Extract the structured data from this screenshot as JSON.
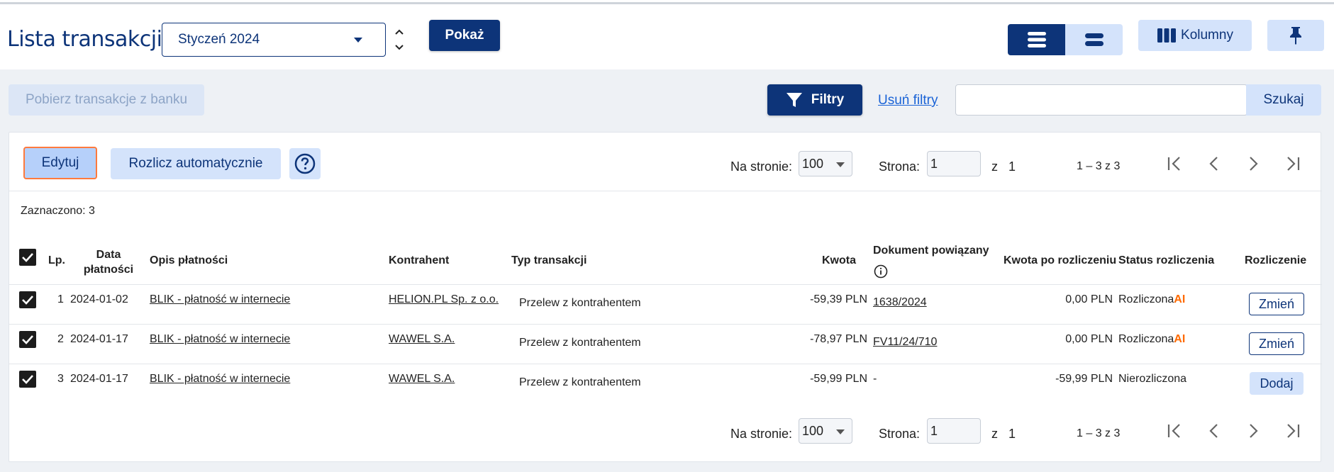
{
  "header": {
    "title": "Lista transakcji",
    "month_value": "Styczeń 2024",
    "show_label": "Pokaż",
    "columns_label": "Kolumny"
  },
  "toolbar": {
    "fetch_label": "Pobierz transakcje z banku",
    "filters_label": "Filtry",
    "clear_filters_label": "Usuń filtry",
    "search_placeholder": "",
    "search_label": "Szukaj"
  },
  "actions": {
    "edit_label": "Edytuj",
    "auto_settle_label": "Rozlicz automatycznie"
  },
  "pagination": {
    "per_page_label": "Na stronie:",
    "per_page_value": "100",
    "page_label": "Strona:",
    "page_value": "1",
    "of_label": "z",
    "total_pages": "1",
    "range_text": "1 – 3 z 3"
  },
  "selection": {
    "text": "Zaznaczono: 3"
  },
  "table": {
    "headers": {
      "lp": "Lp.",
      "date_line1": "Data",
      "date_line2": "płatności",
      "description": "Opis płatności",
      "contractor": "Kontrahent",
      "type": "Typ transakcji",
      "amount": "Kwota",
      "document": "Dokument powiązany",
      "amount_after": "Kwota po rozliczeniu",
      "status": "Status rozliczenia",
      "settlement": "Rozliczenie"
    },
    "rows": [
      {
        "lp": "1",
        "date": "2024-01-02",
        "description": "BLIK - płatność w internecie",
        "contractor": "HELION.PL Sp. z o.o.",
        "type": "Przelew z kontrahentem",
        "amount": "-59,39 PLN",
        "document": "1638/2024",
        "amount_after": "0,00 PLN",
        "status": "Rozliczona",
        "ai": "AI",
        "action": "Zmień"
      },
      {
        "lp": "2",
        "date": "2024-01-17",
        "description": "BLIK - płatność w internecie",
        "contractor": "WAWEL S.A.",
        "type": "Przelew z kontrahentem",
        "amount": "-78,97 PLN",
        "document": "FV11/24/710",
        "amount_after": "0,00 PLN",
        "status": "Rozliczona",
        "ai": "AI",
        "action": "Zmień"
      },
      {
        "lp": "3",
        "date": "2024-01-17",
        "description": "BLIK - płatność w internecie",
        "contractor": "WAWEL S.A.",
        "type": "Przelew z kontrahentem",
        "amount": "-59,99 PLN",
        "document": "-",
        "amount_after": "-59,99 PLN",
        "status": "Nierozliczona",
        "ai": "",
        "action": "Dodaj"
      }
    ]
  },
  "colors": {
    "primary": "#0d3479",
    "light": "#d4e3fb",
    "link": "#1a63d6",
    "ai": "#ff6a00"
  }
}
